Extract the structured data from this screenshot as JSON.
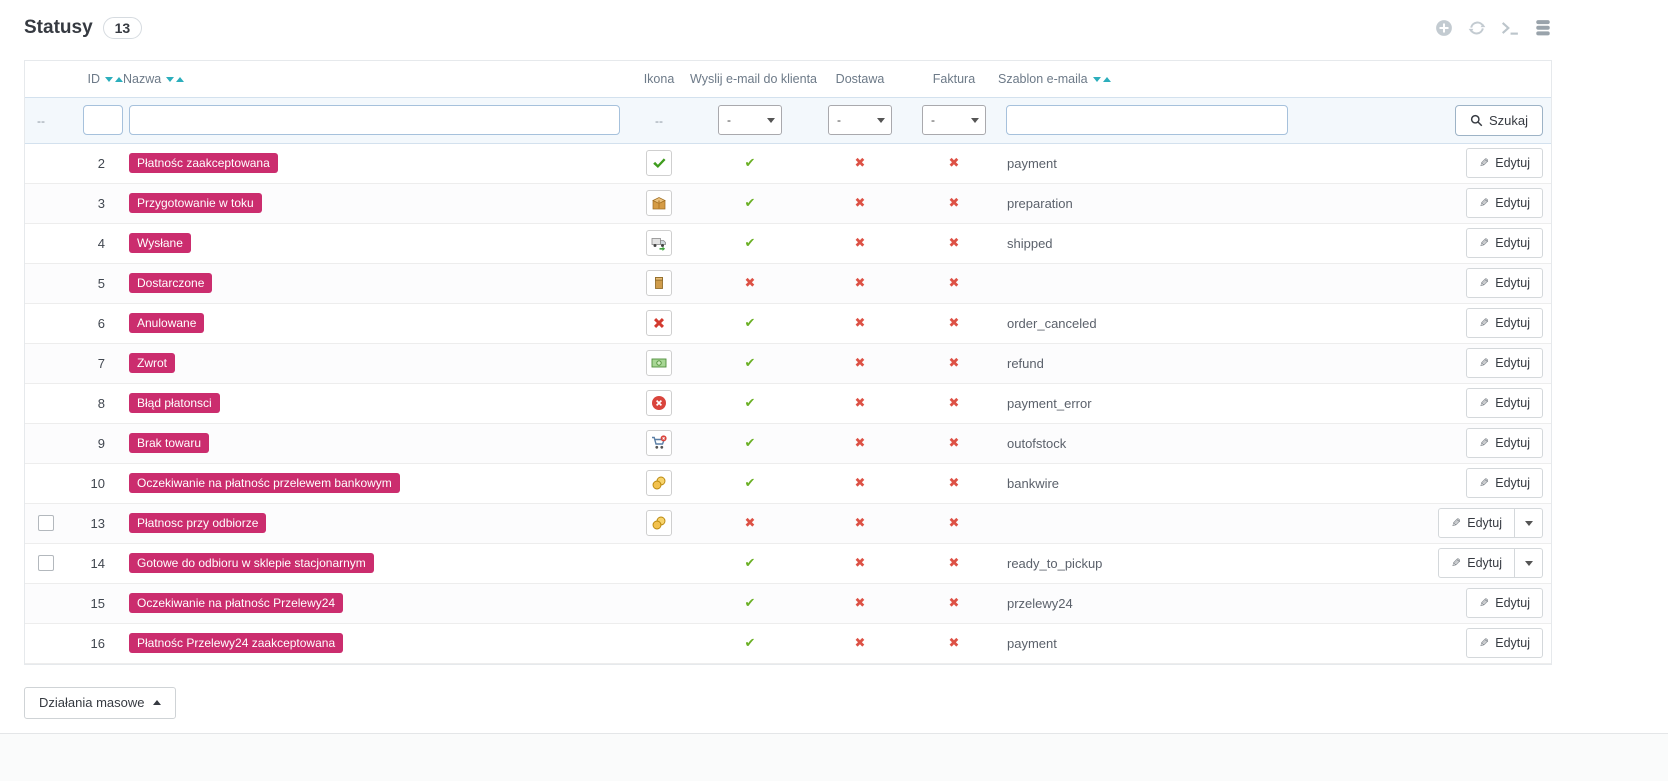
{
  "colors": {
    "badge": "#cb2d6e",
    "check": "#6ab024",
    "cross": "#dd5145",
    "sort": "#2caebc"
  },
  "header": {
    "title": "Statusy",
    "count": "13"
  },
  "toolbar": {
    "icons": [
      {
        "name": "add-icon"
      },
      {
        "name": "refresh-icon"
      },
      {
        "name": "terminal-icon"
      },
      {
        "name": "database-icon"
      }
    ]
  },
  "table": {
    "columns": {
      "id": "ID",
      "name": "Nazwa",
      "icon": "Ikona",
      "email": "Wyslij e-mail do klienta",
      "delivery": "Dostawa",
      "invoice": "Faktura",
      "template": "Szablon e-maila"
    },
    "filters": {
      "checkbox_placeholder": "--",
      "icon_placeholder": "--",
      "select_value": "-",
      "search_button": "Szukaj"
    },
    "edit_label": "Edytuj",
    "rows": [
      {
        "id": "2",
        "name": "Płatnośc zaakceptowana",
        "icon": "check-circle-icon",
        "email": true,
        "delivery": false,
        "invoice": false,
        "template": "payment",
        "checkbox": false,
        "dropdown": false
      },
      {
        "id": "3",
        "name": "Przygotowanie w toku",
        "icon": "package-icon",
        "email": true,
        "delivery": false,
        "invoice": false,
        "template": "preparation",
        "checkbox": false,
        "dropdown": false
      },
      {
        "id": "4",
        "name": "Wysłane",
        "icon": "truck-icon",
        "email": true,
        "delivery": false,
        "invoice": false,
        "template": "shipped",
        "checkbox": false,
        "dropdown": false
      },
      {
        "id": "5",
        "name": "Dostarczone",
        "icon": "box-icon",
        "email": false,
        "delivery": false,
        "invoice": false,
        "template": "",
        "checkbox": false,
        "dropdown": false
      },
      {
        "id": "6",
        "name": "Anulowane",
        "icon": "cancel-icon",
        "email": true,
        "delivery": false,
        "invoice": false,
        "template": "order_canceled",
        "checkbox": false,
        "dropdown": false
      },
      {
        "id": "7",
        "name": "Zwrot",
        "icon": "money-icon",
        "email": true,
        "delivery": false,
        "invoice": false,
        "template": "refund",
        "checkbox": false,
        "dropdown": false
      },
      {
        "id": "8",
        "name": "Błąd płatonsci",
        "icon": "payment-error-icon",
        "email": true,
        "delivery": false,
        "invoice": false,
        "template": "payment_error",
        "checkbox": false,
        "dropdown": false
      },
      {
        "id": "9",
        "name": "Brak towaru",
        "icon": "cart-error-icon",
        "email": true,
        "delivery": false,
        "invoice": false,
        "template": "outofstock",
        "checkbox": false,
        "dropdown": false
      },
      {
        "id": "10",
        "name": "Oczekiwanie na płatnośc przelewem bankowym",
        "icon": "coins-icon",
        "email": true,
        "delivery": false,
        "invoice": false,
        "template": "bankwire",
        "checkbox": false,
        "dropdown": false
      },
      {
        "id": "13",
        "name": "Płatnosc przy odbiorze",
        "icon": "coins-icon",
        "email": false,
        "delivery": false,
        "invoice": false,
        "template": "",
        "checkbox": true,
        "dropdown": true
      },
      {
        "id": "14",
        "name": "Gotowe do odbioru w sklepie stacjonarnym",
        "icon": "",
        "email": true,
        "delivery": false,
        "invoice": false,
        "template": "ready_to_pickup",
        "checkbox": true,
        "dropdown": true
      },
      {
        "id": "15",
        "name": "Oczekiwanie na płatnośc Przelewy24",
        "icon": "",
        "email": true,
        "delivery": false,
        "invoice": false,
        "template": "przelewy24",
        "checkbox": false,
        "dropdown": false
      },
      {
        "id": "16",
        "name": "Płatnośc Przelewy24 zaakceptowana",
        "icon": "",
        "email": true,
        "delivery": false,
        "invoice": false,
        "template": "payment",
        "checkbox": false,
        "dropdown": false
      }
    ]
  },
  "bulk": {
    "label": "Działania masowe"
  }
}
